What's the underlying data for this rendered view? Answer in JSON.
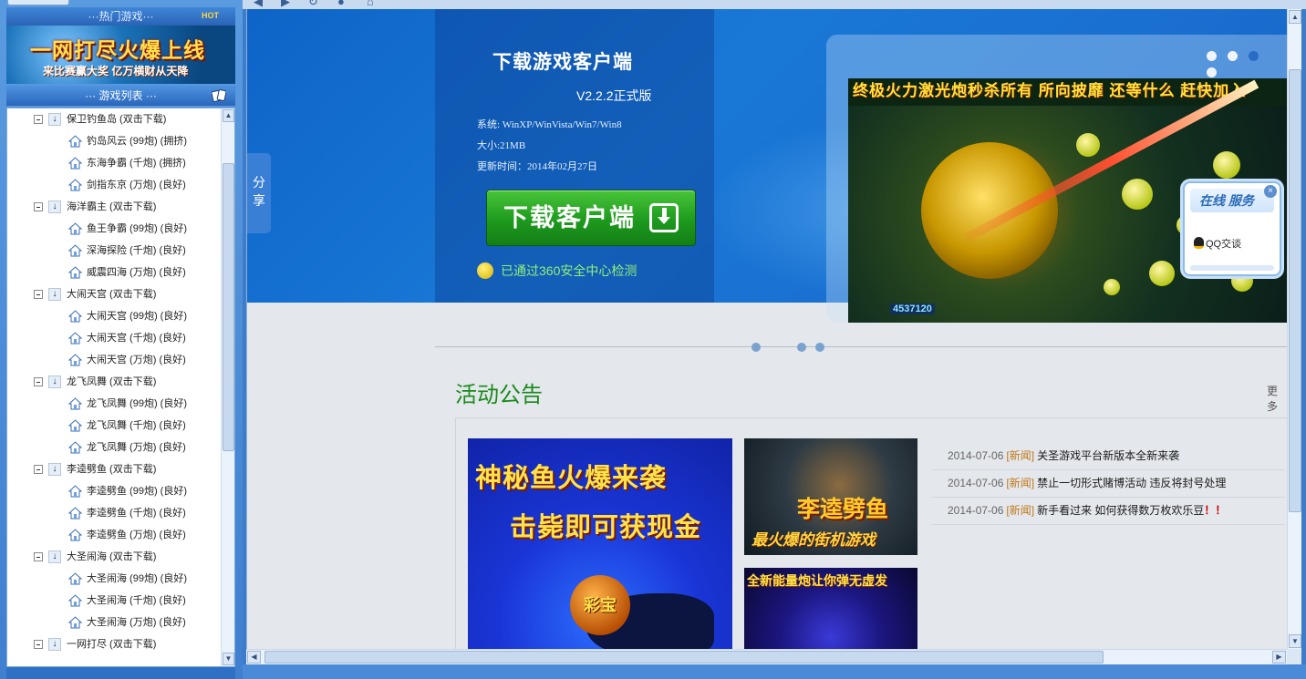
{
  "sidebar": {
    "hot_header": "···热门游戏···",
    "hot_badge": "HOT",
    "banner": {
      "headline": "一网打尽火爆上线",
      "subline": "来比赛赢大奖 亿万横财从天降"
    },
    "list_header": "··· 游戏列表 ···",
    "tree": [
      {
        "type": "parent",
        "label": "保卫钓鱼岛 (双击下载)"
      },
      {
        "type": "child",
        "label": "钓岛风云 (99炮) (拥挤)"
      },
      {
        "type": "child",
        "label": "东海争霸 (千炮) (拥挤)"
      },
      {
        "type": "child",
        "label": "剑指东京 (万炮) (良好)"
      },
      {
        "type": "parent",
        "label": "海洋霸主 (双击下载)"
      },
      {
        "type": "child",
        "label": "鱼王争霸 (99炮) (良好)"
      },
      {
        "type": "child",
        "label": "深海探险 (千炮) (良好)"
      },
      {
        "type": "child",
        "label": "威震四海 (万炮) (良好)"
      },
      {
        "type": "parent",
        "label": "大闹天宫 (双击下载)"
      },
      {
        "type": "child",
        "label": "大闹天宫 (99炮) (良好)"
      },
      {
        "type": "child",
        "label": "大闹天宫 (千炮) (良好)"
      },
      {
        "type": "child",
        "label": "大闹天宫 (万炮) (良好)"
      },
      {
        "type": "parent",
        "label": "龙飞凤舞 (双击下载)"
      },
      {
        "type": "child",
        "label": "龙飞凤舞 (99炮) (良好)"
      },
      {
        "type": "child",
        "label": "龙飞凤舞 (千炮) (良好)"
      },
      {
        "type": "child",
        "label": "龙飞凤舞 (万炮) (良好)"
      },
      {
        "type": "parent",
        "label": "李逵劈鱼 (双击下载)"
      },
      {
        "type": "child",
        "label": "李逵劈鱼 (99炮) (良好)"
      },
      {
        "type": "child",
        "label": "李逵劈鱼 (千炮) (良好)"
      },
      {
        "type": "child",
        "label": "李逵劈鱼 (万炮) (良好)"
      },
      {
        "type": "parent",
        "label": "大圣闹海 (双击下载)"
      },
      {
        "type": "child",
        "label": "大圣闹海 (99炮) (良好)"
      },
      {
        "type": "child",
        "label": "大圣闹海 (千炮) (良好)"
      },
      {
        "type": "child",
        "label": "大圣闹海 (万炮) (良好)"
      },
      {
        "type": "parent",
        "label": "一网打尽 (双击下载)"
      }
    ]
  },
  "nav": {
    "back": "◀",
    "forward": "▶",
    "refresh": "↻",
    "stop": "●",
    "home": "⌂"
  },
  "download": {
    "title": "下载游戏客户端",
    "version": "V2.2.2正式版",
    "system": "系统: WinXP/WinVista/Win7/Win8",
    "size": "大小:21MB",
    "updated": "更新时间：2014年02月27日",
    "button_label": "下载客户端",
    "safety": "已通过360安全中心检测"
  },
  "share_label": "分享",
  "slider": {
    "caption": "终极火力激光炮秒杀所有 所向披靡 还等什么 赶快加入",
    "score": "4537120",
    "active_dot": 2,
    "dot_count": 4
  },
  "service_widget": {
    "title": "在线 服务",
    "close": "×",
    "qq_label": "QQ交谈"
  },
  "activity": {
    "title": "活动公告",
    "more": "更多",
    "promo1_line1": "神秘鱼火爆来袭",
    "promo1_line2": "击毙即可获现金",
    "promo1_coin": "彩宝",
    "promo2_title": "李逵劈鱼",
    "promo2_sub": "最火爆的街机游戏",
    "promo3_title": "全新能量炮让你弹无虚发",
    "news": [
      {
        "date": "2014-07-06",
        "tag": "[新闻]",
        "title": "关圣游戏平台新版本全新来袭",
        "mark": ""
      },
      {
        "date": "2014-07-06",
        "tag": "[新闻]",
        "title": "禁止一切形式赌博活动 违反将封号处理",
        "mark": ""
      },
      {
        "date": "2014-07-06",
        "tag": "[新闻]",
        "title": "新手看过来  如何获得数万枚欢乐豆",
        "mark": "！！"
      }
    ]
  },
  "colors": {
    "accent_green": "#1a8a1a",
    "hero_blue": "#1978d6",
    "news_tag": "#c07a1a"
  }
}
